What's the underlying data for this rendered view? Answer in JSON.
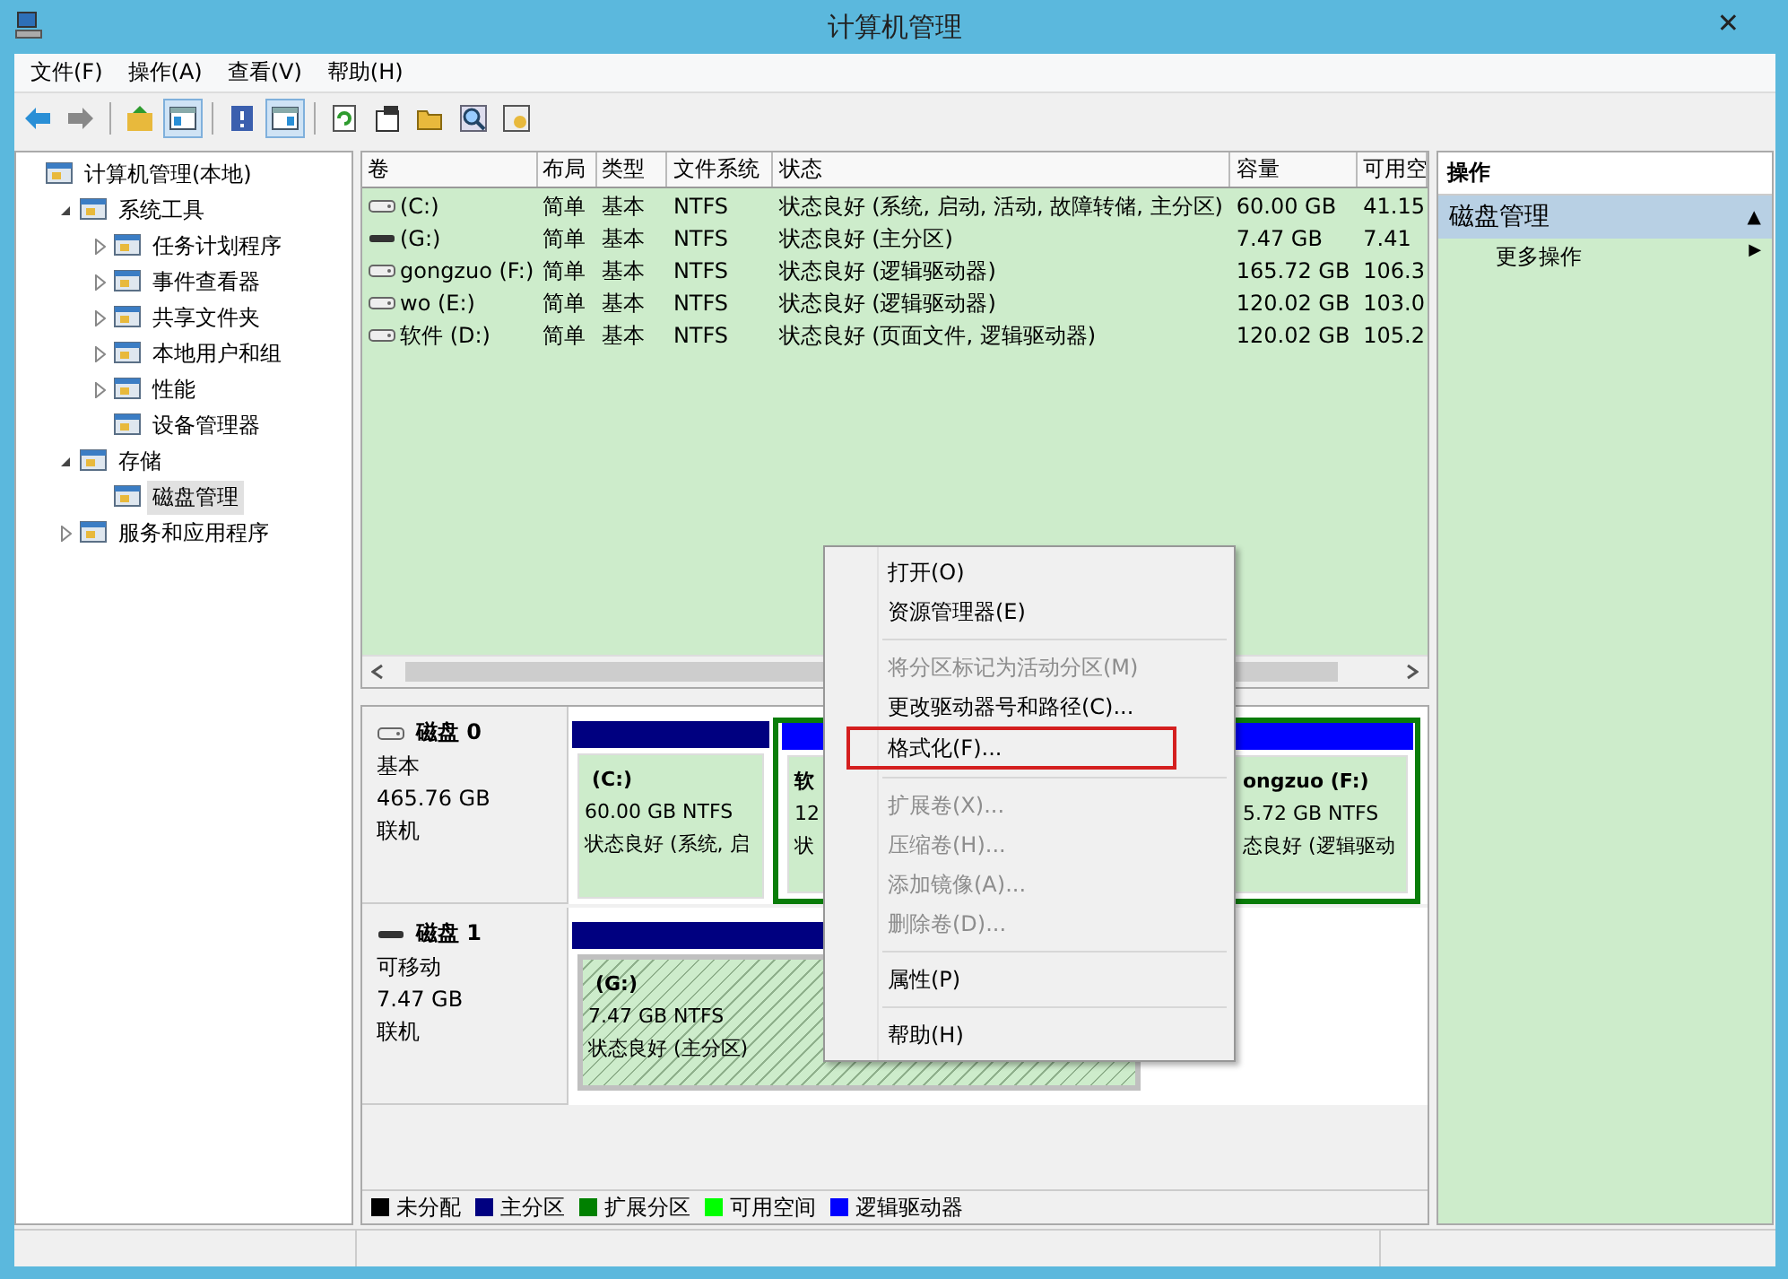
{
  "window": {
    "title": "计算机管理",
    "close": "✕"
  },
  "menu_bar": [
    "文件(F)",
    "操作(A)",
    "查看(V)",
    "帮助(H)"
  ],
  "toolbar": [
    {
      "pressed": false
    },
    {
      "pressed": false
    },
    {
      "pressed": false
    },
    {
      "pressed": true
    },
    {
      "pressed": false
    },
    {
      "pressed": true
    },
    {
      "pressed": false
    },
    {
      "pressed": false
    },
    {
      "pressed": false
    },
    {
      "pressed": false
    },
    {
      "pressed": false
    }
  ],
  "tree": [
    {
      "label": "计算机管理(本地)",
      "selected": false,
      "children": [
        {
          "label": "系统工具",
          "selected": false,
          "expanded": true,
          "children": [
            {
              "label": "任务计划程序",
              "selected": false,
              "expanded": false
            },
            {
              "label": "事件查看器",
              "selected": false,
              "expanded": false
            },
            {
              "label": "共享文件夹",
              "selected": false,
              "expanded": false
            },
            {
              "label": "本地用户和组",
              "selected": false,
              "expanded": false
            },
            {
              "label": "性能",
              "selected": false,
              "expanded": false
            },
            {
              "label": "设备管理器",
              "selected": false
            }
          ]
        },
        {
          "label": "存储",
          "selected": false,
          "expanded": true,
          "children": [
            {
              "label": "磁盘管理",
              "selected": true
            }
          ]
        },
        {
          "label": "服务和应用程序",
          "selected": false,
          "expanded": false
        }
      ]
    }
  ],
  "table": {
    "columns": [
      "卷",
      "布局",
      "类型",
      "文件系统",
      "状态",
      "容量",
      "可用空"
    ],
    "rows": [
      {
        "removable": false,
        "cells": [
          "(C:)",
          "简单",
          "基本",
          "NTFS",
          "状态良好 (系统, 启动, 活动, 故障转储, 主分区)",
          "60.00 GB",
          "41.15"
        ]
      },
      {
        "removable": true,
        "cells": [
          "(G:)",
          "简单",
          "基本",
          "NTFS",
          "状态良好 (主分区)",
          "7.47 GB",
          "7.41"
        ]
      },
      {
        "removable": false,
        "cells": [
          "gongzuo (F:)",
          "简单",
          "基本",
          "NTFS",
          "状态良好 (逻辑驱动器)",
          "165.72 GB",
          "106.3"
        ]
      },
      {
        "removable": false,
        "cells": [
          "wo (E:)",
          "简单",
          "基本",
          "NTFS",
          "状态良好 (逻辑驱动器)",
          "120.02 GB",
          "103.0"
        ]
      },
      {
        "removable": false,
        "cells": [
          "软件 (D:)",
          "简单",
          "基本",
          "NTFS",
          "状态良好 (页面文件, 逻辑驱动器)",
          "120.02 GB",
          "105.2"
        ]
      }
    ]
  },
  "disks": [
    {
      "name": "磁盘 0",
      "removable": false,
      "lines": [
        "基本",
        "465.76 GB",
        "联机"
      ],
      "partitions": [
        {
          "kind": "primary",
          "selected": false,
          "label": "(C:)",
          "size": "60.00 GB NTFS",
          "status": "状态良好 (系统, 启"
        },
        {
          "kind": "extended",
          "children": [
            {
              "kind": "logical",
              "selected": false,
              "label": "软",
              "size": "12",
              "status": "状"
            },
            {
              "kind": "logical",
              "selected": false,
              "label": "ongzuo  (F:)",
              "size": "5.72 GB NTFS",
              "status": "态良好 (逻辑驱动"
            }
          ]
        }
      ]
    },
    {
      "name": "磁盘 1",
      "removable": true,
      "lines": [
        "可移动",
        "7.47 GB",
        "联机"
      ],
      "partitions": [
        {
          "kind": "primary",
          "selected": true,
          "label": "(G:)",
          "size": "7.47 GB NTFS",
          "status": "状态良好 (主分区)"
        }
      ]
    }
  ],
  "legend": [
    {
      "label": "未分配",
      "color": "#000000"
    },
    {
      "label": "主分区",
      "color": "#000080"
    },
    {
      "label": "扩展分区",
      "color": "#008000"
    },
    {
      "label": "可用空间",
      "color": "#00ff00"
    },
    {
      "label": "逻辑驱动器",
      "color": "#0000ff"
    }
  ],
  "actions": {
    "header": "操作",
    "section": {
      "label": "磁盘管理",
      "glyph": "▲"
    },
    "items": [
      {
        "label": "更多操作",
        "glyph": "▶"
      }
    ]
  },
  "context_menu": [
    {
      "kind": "item",
      "label": "打开(O)",
      "disabled": false,
      "highlighted": false
    },
    {
      "kind": "item",
      "label": "资源管理器(E)",
      "disabled": false,
      "highlighted": false
    },
    {
      "kind": "separator"
    },
    {
      "kind": "item",
      "label": "将分区标记为活动分区(M)",
      "disabled": true,
      "highlighted": false
    },
    {
      "kind": "item",
      "label": "更改驱动器号和路径(C)...",
      "disabled": false,
      "highlighted": false
    },
    {
      "kind": "item",
      "label": "格式化(F)...",
      "disabled": false,
      "highlighted": true
    },
    {
      "kind": "separator"
    },
    {
      "kind": "item",
      "label": "扩展卷(X)...",
      "disabled": true,
      "highlighted": false
    },
    {
      "kind": "item",
      "label": "压缩卷(H)...",
      "disabled": true,
      "highlighted": false
    },
    {
      "kind": "item",
      "label": "添加镜像(A)...",
      "disabled": true,
      "highlighted": false
    },
    {
      "kind": "item",
      "label": "删除卷(D)...",
      "disabled": true,
      "highlighted": false
    },
    {
      "kind": "separator"
    },
    {
      "kind": "item",
      "label": "属性(P)",
      "disabled": false,
      "highlighted": false
    },
    {
      "kind": "separator"
    },
    {
      "kind": "item",
      "label": "帮助(H)",
      "disabled": false,
      "highlighted": false
    }
  ]
}
